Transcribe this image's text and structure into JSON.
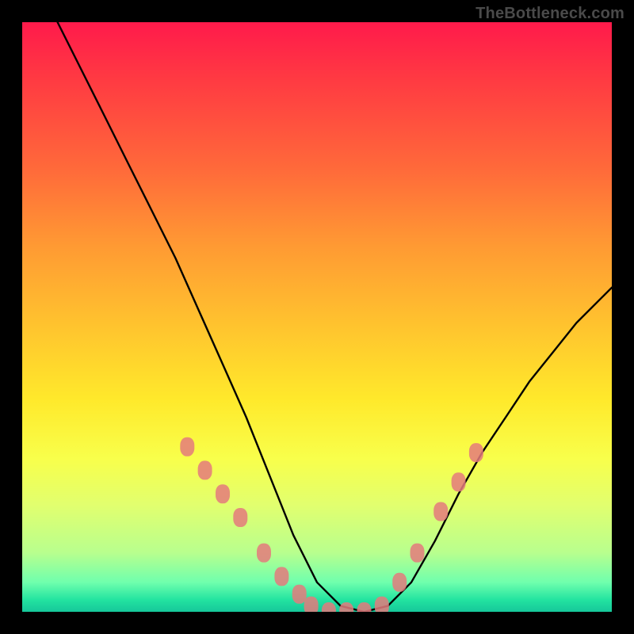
{
  "watermark": {
    "text": "TheBottleneck.com"
  },
  "chart_data": {
    "type": "line",
    "title": "",
    "xlabel": "",
    "ylabel": "",
    "xlim": [
      0,
      100
    ],
    "ylim": [
      0,
      100
    ],
    "grid": false,
    "legend": false,
    "background_gradient": {
      "stops": [
        {
          "pct": 0,
          "color": "#ff1a4b"
        },
        {
          "pct": 25,
          "color": "#ff6a3a"
        },
        {
          "pct": 50,
          "color": "#ffc52e"
        },
        {
          "pct": 75,
          "color": "#f8ff4b"
        },
        {
          "pct": 100,
          "color": "#16c79a"
        }
      ]
    },
    "series": [
      {
        "name": "bottleneck-curve",
        "color": "#000000",
        "x": [
          6,
          10,
          14,
          18,
          22,
          26,
          30,
          34,
          38,
          42,
          46,
          50,
          54,
          58,
          62,
          66,
          70,
          74,
          78,
          82,
          86,
          90,
          94,
          98,
          100
        ],
        "values": [
          100,
          92,
          84,
          76,
          68,
          60,
          51,
          42,
          33,
          23,
          13,
          5,
          1,
          0,
          1,
          5,
          12,
          20,
          27,
          33,
          39,
          44,
          49,
          53,
          55
        ]
      }
    ],
    "markers": [
      {
        "name": "left-arm-dots",
        "color": "#e47a7d",
        "shape": "rounded-rect",
        "points": [
          {
            "x": 28,
            "y": 28
          },
          {
            "x": 31,
            "y": 24
          },
          {
            "x": 34,
            "y": 20
          },
          {
            "x": 37,
            "y": 16
          },
          {
            "x": 41,
            "y": 10
          },
          {
            "x": 44,
            "y": 6
          },
          {
            "x": 47,
            "y": 3
          }
        ]
      },
      {
        "name": "valley-dots",
        "color": "#e47a7d",
        "shape": "rounded-rect",
        "points": [
          {
            "x": 49,
            "y": 1
          },
          {
            "x": 52,
            "y": 0
          },
          {
            "x": 55,
            "y": 0
          },
          {
            "x": 58,
            "y": 0
          },
          {
            "x": 61,
            "y": 1
          }
        ]
      },
      {
        "name": "right-arm-dots",
        "color": "#e47a7d",
        "shape": "rounded-rect",
        "points": [
          {
            "x": 64,
            "y": 5
          },
          {
            "x": 67,
            "y": 10
          },
          {
            "x": 71,
            "y": 17
          },
          {
            "x": 74,
            "y": 22
          },
          {
            "x": 77,
            "y": 27
          }
        ]
      }
    ]
  }
}
